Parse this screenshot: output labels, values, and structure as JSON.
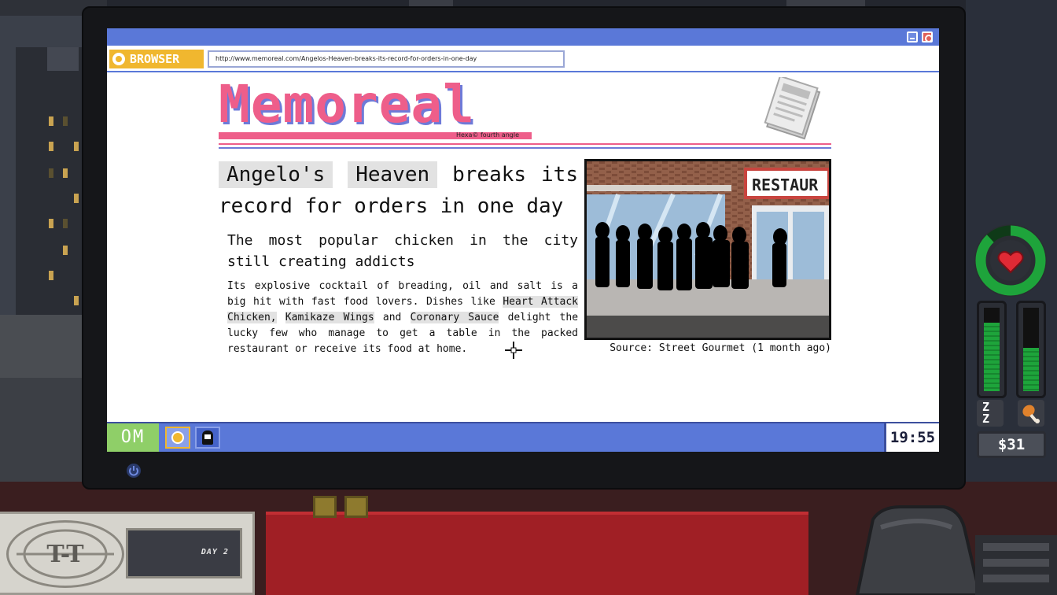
{
  "browser": {
    "tab_label": "BROWSER",
    "url": "http://www.memoreal.com/Angelos-Heaven-breaks-its-record-for-orders-in-one-day"
  },
  "site": {
    "logo": "Memoreal",
    "tagline": "Hexa© fourth angle"
  },
  "article": {
    "headline_highlight_1": "Angelo's",
    "headline_highlight_2": "Heaven",
    "headline_rest": "breaks its record for orders in one day",
    "subheadline": "The most popular chicken in the city still creating addicts",
    "body_intro": "Its explosive cocktail of breading, oil and salt is a big hit with fast food lovers. Dishes like",
    "dish_1": "Heart Attack Chicken,",
    "dish_2": "Kamikaze Wings",
    "body_and": "and",
    "dish_3": "Coronary Sauce",
    "body_outro": "delight the lucky few who manage to get a table in the packed restaurant or receive its food at home.",
    "photo_sign": "RESTAUR",
    "photo_caption": "Source: Street Gourmet (1 month ago)"
  },
  "taskbar": {
    "start_label": "OM",
    "clock": "19:55"
  },
  "hud": {
    "health_level": 0.88,
    "sleep_level": 0.82,
    "hunger_level": 0.52,
    "sleep_symbol": "Z\nZ",
    "money": "$31"
  },
  "desk": {
    "day_label": "DAY 2",
    "card_logo": "T-T"
  },
  "colors": {
    "logo_pink": "#ee5e8a",
    "logo_blue": "#6e7ad8",
    "titlebar_blue": "#5a78d8",
    "browser_yellow": "#f0b72f",
    "start_green": "#8fcf68",
    "health_green": "#1ea43b"
  }
}
